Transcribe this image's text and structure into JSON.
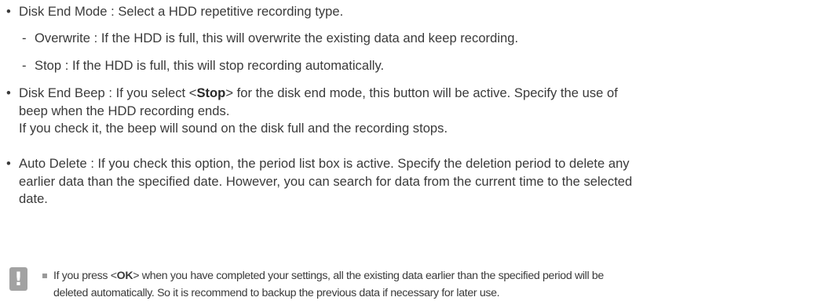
{
  "items": {
    "disk_end_mode": {
      "bullet": "•",
      "text": "Disk End Mode : Select a HDD repetitive recording type."
    },
    "overwrite": {
      "dash": "-",
      "text": "Overwrite : If the HDD is full, this will overwrite the existing data and keep recording."
    },
    "stop": {
      "dash": "-",
      "text": "Stop : If the HDD is full, this will stop recording automatically."
    },
    "disk_end_beep": {
      "bullet": "•",
      "text_before": "Disk End Beep : If you select <",
      "keyword": "Stop",
      "text_after": "> for the disk end mode, this button will be active. Specify the use of",
      "line2": "beep when the HDD recording ends.",
      "line3": "If you check it, the beep will sound on the disk full and the recording stops."
    },
    "auto_delete": {
      "bullet": "•",
      "line1": "Auto Delete : If you check this option, the period list box is active. Specify the deletion period to delete any",
      "line2": "earlier data than the specified date. However, you can search for data from the current time to the selected",
      "line3": "date."
    }
  },
  "note": {
    "icon_glyph": "!",
    "text_before": "If you press <",
    "keyword": "OK",
    "text_after": "> when you have completed your settings, all the existing data earlier than the specified period will be",
    "line2": "deleted automatically. So it is recommend to backup the previous data if necessary for later use."
  }
}
